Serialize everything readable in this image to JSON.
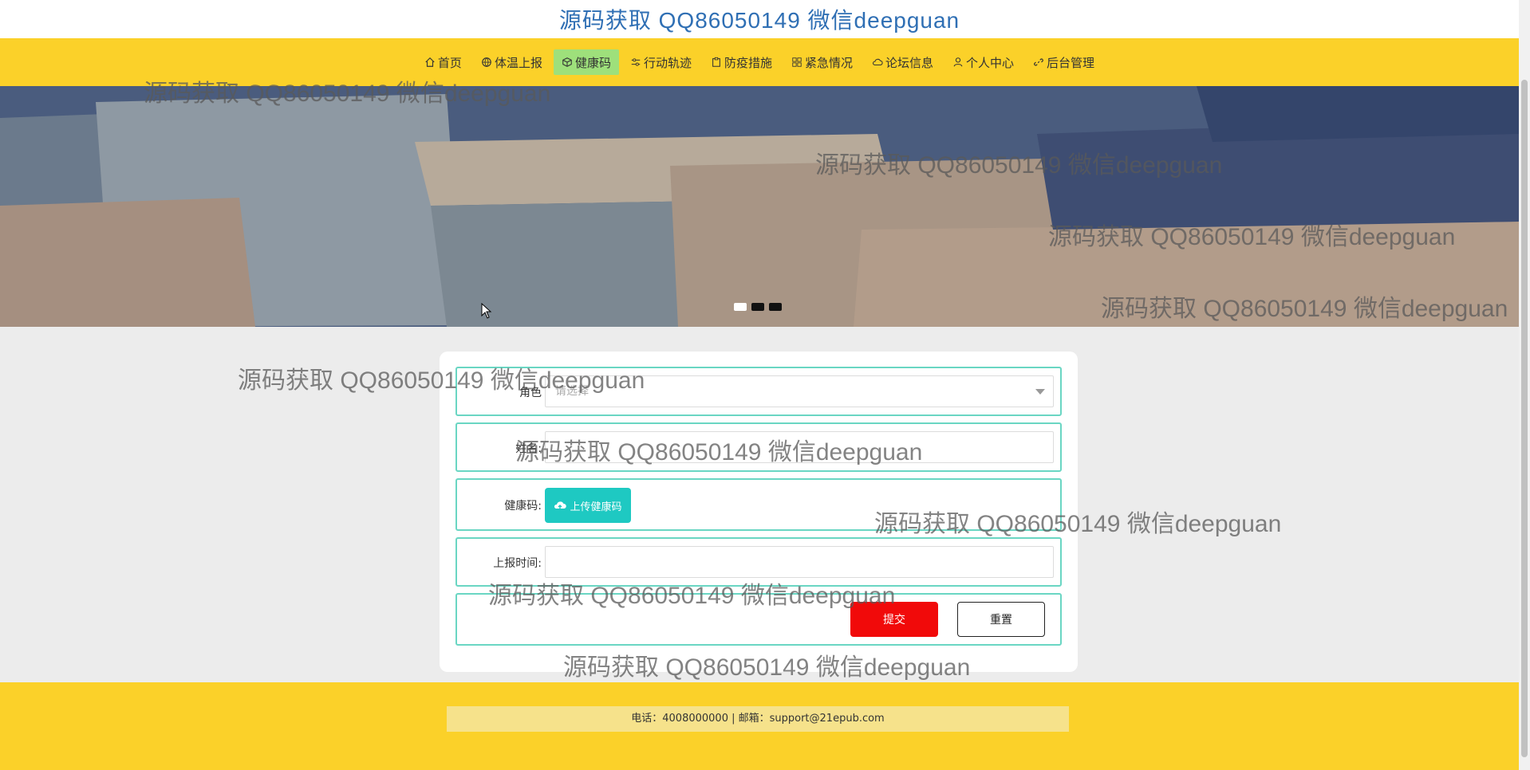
{
  "site": {
    "title": "源码获取 QQ86050149 微信deepguan"
  },
  "nav": {
    "items": [
      {
        "label": "首页",
        "icon": "home-icon"
      },
      {
        "label": "体温上报",
        "icon": "globe-icon"
      },
      {
        "label": "健康码",
        "icon": "cube-icon",
        "active": true
      },
      {
        "label": "行动轨迹",
        "icon": "sliders-icon"
      },
      {
        "label": "防疫措施",
        "icon": "clipboard-icon"
      },
      {
        "label": "紧急情况",
        "icon": "grid-icon"
      },
      {
        "label": "论坛信息",
        "icon": "cloud-icon"
      },
      {
        "label": "个人中心",
        "icon": "user-icon"
      },
      {
        "label": "后台管理",
        "icon": "link-icon"
      }
    ]
  },
  "banner": {
    "slide_count": 3,
    "active_slide": 1
  },
  "form": {
    "role": {
      "label": "角色",
      "placeholder": "请选择"
    },
    "name": {
      "label": "姓名:",
      "value": ""
    },
    "health_code": {
      "label": "健康码:",
      "upload_label": "上传健康码"
    },
    "report_time": {
      "label": "上报时间:",
      "value": ""
    },
    "submit_label": "提交",
    "reset_label": "重置"
  },
  "footer": {
    "contact": "电话：4008000000 | 邮箱：support@21epub.com"
  },
  "watermark": "源码获取 QQ86050149 微信deepguan",
  "colors": {
    "nav": "#fbd129",
    "active_nav": "#9ee07b",
    "submit": "#f10a0a",
    "upload": "#1ec9c2",
    "row_border": "#6ad6c3"
  }
}
